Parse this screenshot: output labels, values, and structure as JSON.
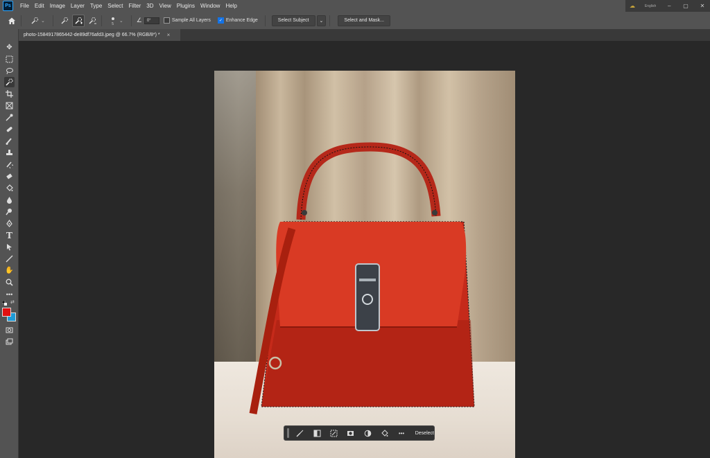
{
  "app": {
    "logo_text": "Ps",
    "menu": [
      "File",
      "Edit",
      "Image",
      "Layer",
      "Type",
      "Select",
      "Filter",
      "3D",
      "View",
      "Plugins",
      "Window",
      "Help"
    ],
    "language": "English"
  },
  "options_bar": {
    "angle_value": "0°",
    "sample_all_layers": {
      "label": "Sample All Layers",
      "checked": false
    },
    "enhance_edge": {
      "label": "Enhance Edge",
      "checked": true
    },
    "select_subject_label": "Select Subject",
    "select_and_mask_label": "Select and Mask..."
  },
  "document": {
    "tab_title": "photo-1584917865442-de89df76afd3.jpeg @ 66.7% (RGB/8*) *",
    "tab_close": "×"
  },
  "toolbox": {
    "foreground_color": "#e01010",
    "background_color": "#1e9ad6"
  },
  "task_bar": {
    "deselect_label": "Deselect"
  },
  "colors": {
    "bag": "#d4301e",
    "bag_dark": "#9e1c10",
    "accent": "#1473e6"
  }
}
